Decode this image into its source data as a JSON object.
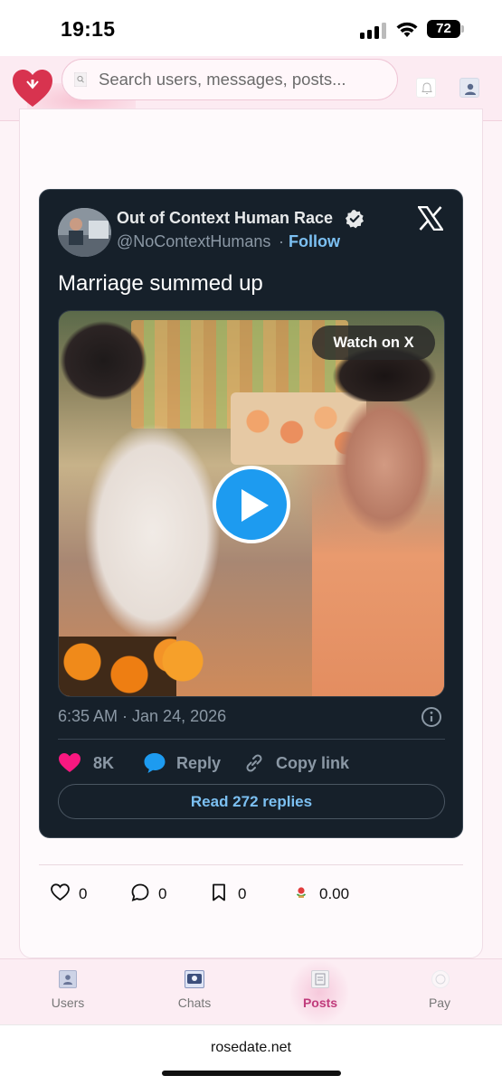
{
  "status_bar": {
    "time": "19:15",
    "battery_level": "72",
    "signal_icon": "signal-bars-icon",
    "wifi_icon": "wifi-icon"
  },
  "header": {
    "logo_icon": "heart-logo-icon",
    "search": {
      "placeholder": "Search users, messages, posts...",
      "value": ""
    },
    "notification_icon": "bell-icon",
    "profile_icon": "profile-icon"
  },
  "tweet": {
    "author_name": "Out of Context Human Race",
    "handle": "@NoContextHumans",
    "separator": "·",
    "follow_label": "Follow",
    "text": "Marriage summed up",
    "watch_label": "Watch on X",
    "timestamp": "6:35 AM · Jan 24, 2026",
    "likes": "8K",
    "reply_label": "Reply",
    "copy_link_label": "Copy link",
    "read_replies_label": "Read 272 replies",
    "accent_color": "#1d9bf0",
    "like_color": "#f91880"
  },
  "post_actions": {
    "likes": "0",
    "comments": "0",
    "bookmarks": "0",
    "tips": "0.00"
  },
  "tabs": [
    {
      "label": "Users",
      "icon": "users-icon"
    },
    {
      "label": "Chats",
      "icon": "chats-icon"
    },
    {
      "label": "Posts",
      "icon": "posts-icon",
      "active": true
    },
    {
      "label": "Pay",
      "icon": "pay-icon"
    }
  ],
  "browser": {
    "url": "rosedate.net"
  },
  "colors": {
    "brand_pink": "#c03c7c",
    "header_bg": "#fcebf2",
    "tweet_bg": "#16202a"
  }
}
